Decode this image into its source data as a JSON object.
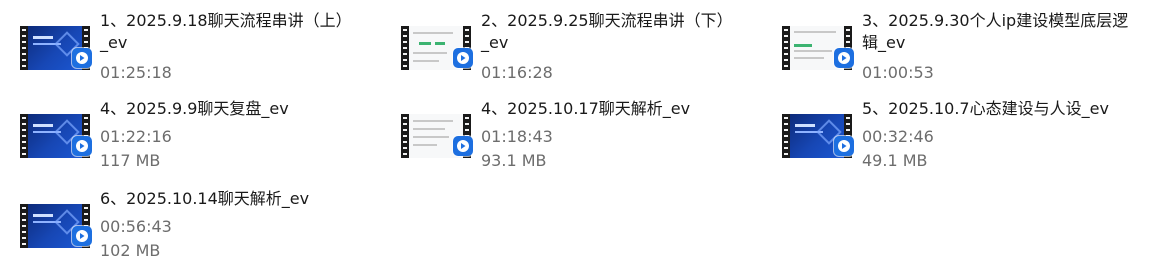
{
  "files": [
    {
      "name": "1、2025.9.18聊天流程串讲（上）_ev",
      "duration": "01:25:18",
      "size": "",
      "thumb": "blue",
      "thumb_text": ""
    },
    {
      "name": "2、2025.9.25聊天流程串讲（下）_ev",
      "duration": "01:16:28",
      "size": "",
      "thumb": "white",
      "thumb_text": ""
    },
    {
      "name": "3、2025.9.30个人ip建设模型底层逻辑_ev",
      "duration": "01:00:53",
      "size": "",
      "thumb": "white",
      "thumb_text": ""
    },
    {
      "name": "4、2025.9.9聊天复盘_ev",
      "duration": "01:22:16",
      "size": "117 MB",
      "thumb": "blue",
      "thumb_text": ""
    },
    {
      "name": "4、2025.10.17聊天解析_ev",
      "duration": "01:18:43",
      "size": "93.1 MB",
      "thumb": "white",
      "thumb_text": ""
    },
    {
      "name": "5、2025.10.7心态建设与人设_ev",
      "duration": "00:32:46",
      "size": "49.1 MB",
      "thumb": "blue",
      "thumb_text": ""
    },
    {
      "name": "6、2025.10.14聊天解析_ev",
      "duration": "00:56:43",
      "size": "102 MB",
      "thumb": "blue",
      "thumb_text": ""
    }
  ],
  "icons": {
    "thumbnail": "video-thumbnail-icon",
    "badge": "video-player-app-icon"
  },
  "colors": {
    "badge": "#1d6fe0",
    "name_text": "#1a1a1a",
    "meta_text": "#6d6d6d",
    "thumb_blue": "#1747b5"
  }
}
